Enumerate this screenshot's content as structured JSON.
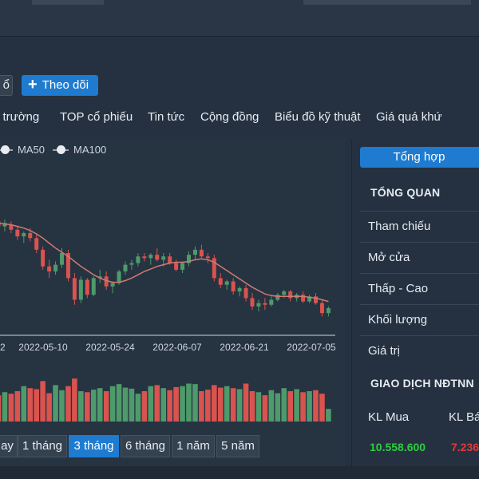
{
  "actions": {
    "cut_button_label": "ổ",
    "follow_label": "Theo dõi"
  },
  "nav": {
    "tabs": [
      "ị trường",
      "TOP cổ phiếu",
      "Tin tức",
      "Cộng đồng",
      "Biểu đồ kỹ thuật",
      "Giá quá khứ"
    ]
  },
  "legend": [
    {
      "label": "MA50"
    },
    {
      "label": "MA100"
    }
  ],
  "colors": {
    "up": "#4e9a6b",
    "down": "#d9534f",
    "ma": "#d27a72",
    "accent": "#1e7bd0",
    "buy": "#2ecc40",
    "sell": "#e23a3a"
  },
  "chart_data": {
    "type": "candlestick",
    "x_tick_labels": [
      "2",
      "2022-05-10",
      "2022-05-24",
      "2022-06-07",
      "2022-06-21",
      "2022-07-05"
    ],
    "candles": [
      [
        35.9,
        36.2,
        35.4,
        35.6
      ],
      [
        35.6,
        36.0,
        35.3,
        35.8
      ],
      [
        35.7,
        35.9,
        35.2,
        35.4
      ],
      [
        35.4,
        35.6,
        34.8,
        35.0
      ],
      [
        35.0,
        35.3,
        34.6,
        35.2
      ],
      [
        35.2,
        35.5,
        34.7,
        34.9
      ],
      [
        34.9,
        35.1,
        34.0,
        34.2
      ],
      [
        34.2,
        34.4,
        33.0,
        33.2
      ],
      [
        33.2,
        33.6,
        32.5,
        32.9
      ],
      [
        32.9,
        33.5,
        32.7,
        33.3
      ],
      [
        33.3,
        34.3,
        33.1,
        34.0
      ],
      [
        34.0,
        34.2,
        32.3,
        32.5
      ],
      [
        32.5,
        32.8,
        30.9,
        31.2
      ],
      [
        31.2,
        32.6,
        31.0,
        32.4
      ],
      [
        32.4,
        32.5,
        31.3,
        31.5
      ],
      [
        31.5,
        32.6,
        31.4,
        32.5
      ],
      [
        32.5,
        33.0,
        32.2,
        32.6
      ],
      [
        32.6,
        32.9,
        31.8,
        32.0
      ],
      [
        32.0,
        32.3,
        31.6,
        32.2
      ],
      [
        32.2,
        33.0,
        32.1,
        32.9
      ],
      [
        32.9,
        33.5,
        32.7,
        33.3
      ],
      [
        33.3,
        33.6,
        33.0,
        33.4
      ],
      [
        33.4,
        34.0,
        33.2,
        33.8
      ],
      [
        33.8,
        34.0,
        33.5,
        33.7
      ],
      [
        33.7,
        34.0,
        33.3,
        33.9
      ],
      [
        33.9,
        34.3,
        33.5,
        33.6
      ],
      [
        33.6,
        34.0,
        33.2,
        33.8
      ],
      [
        33.8,
        34.0,
        33.3,
        33.4
      ],
      [
        33.4,
        33.6,
        32.9,
        33.0
      ],
      [
        33.0,
        33.5,
        32.8,
        33.4
      ],
      [
        33.4,
        34.1,
        33.2,
        33.9
      ],
      [
        33.9,
        34.4,
        33.6,
        34.2
      ],
      [
        34.2,
        34.5,
        33.7,
        33.8
      ],
      [
        33.8,
        34.0,
        33.4,
        33.7
      ],
      [
        33.7,
        33.9,
        32.3,
        32.5
      ],
      [
        32.5,
        32.8,
        31.9,
        32.1
      ],
      [
        32.1,
        32.4,
        31.8,
        32.3
      ],
      [
        32.3,
        32.5,
        31.5,
        31.7
      ],
      [
        31.7,
        32.0,
        31.4,
        31.9
      ],
      [
        31.9,
        32.1,
        31.1,
        31.3
      ],
      [
        31.3,
        31.6,
        30.6,
        30.8
      ],
      [
        30.8,
        31.2,
        30.5,
        31.0
      ],
      [
        31.0,
        31.3,
        30.6,
        30.9
      ],
      [
        30.9,
        31.4,
        30.8,
        31.2
      ],
      [
        31.2,
        31.6,
        31.1,
        31.5
      ],
      [
        31.5,
        31.8,
        31.3,
        31.7
      ],
      [
        31.7,
        31.8,
        31.1,
        31.3
      ],
      [
        31.3,
        31.6,
        31.1,
        31.5
      ],
      [
        31.5,
        31.7,
        31.0,
        31.1
      ],
      [
        31.1,
        31.5,
        31.0,
        31.4
      ],
      [
        31.4,
        31.6,
        30.9,
        31.0
      ],
      [
        31.0,
        31.2,
        30.2,
        30.4
      ],
      [
        30.4,
        30.8,
        30.2,
        30.7
      ]
    ],
    "ma": [
      35.8,
      35.75,
      35.7,
      35.6,
      35.5,
      35.35,
      35.15,
      34.9,
      34.6,
      34.3,
      34.05,
      33.8,
      33.5,
      33.2,
      32.95,
      32.7,
      32.5,
      32.35,
      32.25,
      32.25,
      32.35,
      32.5,
      32.7,
      32.9,
      33.05,
      33.2,
      33.3,
      33.4,
      33.45,
      33.45,
      33.5,
      33.6,
      33.65,
      33.6,
      33.45,
      33.2,
      32.95,
      32.7,
      32.45,
      32.2,
      31.95,
      31.75,
      31.55,
      31.45,
      31.4,
      31.4,
      31.4,
      31.4,
      31.4,
      31.35,
      31.3,
      31.2,
      31.1
    ],
    "ylim": [
      29.5,
      37.4
    ],
    "volume": [
      52,
      58,
      55,
      60,
      70,
      66,
      64,
      80,
      56,
      72,
      62,
      70,
      85,
      60,
      58,
      63,
      66,
      60,
      70,
      74,
      67,
      65,
      55,
      60,
      70,
      72,
      66,
      62,
      68,
      70,
      75,
      74,
      60,
      63,
      72,
      67,
      70,
      66,
      64,
      75,
      60,
      58,
      52,
      62,
      56,
      66,
      60,
      64,
      58,
      60,
      62,
      55,
      25
    ],
    "vol_ylim": [
      0,
      90
    ]
  },
  "periods": [
    "ay",
    "1 tháng",
    "3 tháng",
    "6 tháng",
    "1 năm",
    "5 năm"
  ],
  "active_period": "3 tháng",
  "side": {
    "summary_label": "Tổng hợp",
    "overview_heading": "TỔNG QUAN",
    "rows": [
      "Tham chiếu",
      "Mở cửa",
      "Thấp - Cao",
      "Khối lượng",
      "Giá trị"
    ],
    "foreign_heading": "GIAO DỊCH NĐTNN",
    "col_buy": "KL Mua",
    "col_sell": "KL Bá",
    "buy_value": "10.558.600",
    "sell_value": "7.236"
  }
}
